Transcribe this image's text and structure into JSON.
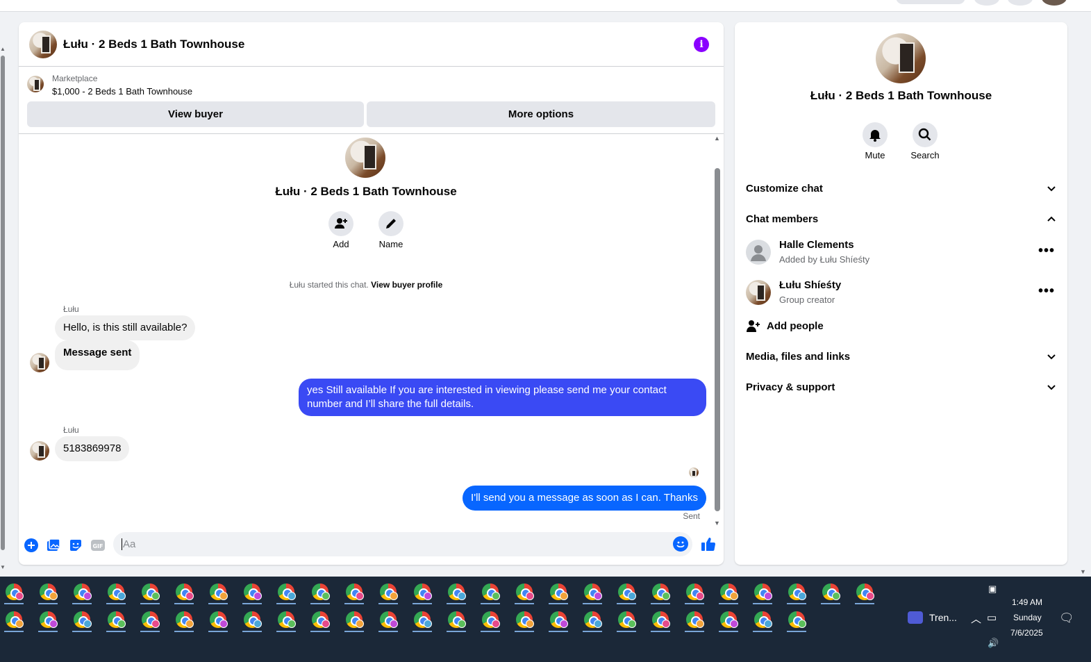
{
  "chat": {
    "title": "Łułu · 2 Beds 1 Bath Townhouse",
    "info_glyph": "i",
    "marketplace": {
      "label": "Marketplace",
      "listing": "$1,000 - 2 Beds 1 Bath Townhouse",
      "view_buyer": "View buyer",
      "more_options": "More options"
    },
    "intro": {
      "title": "Łułu · 2 Beds 1 Bath Townhouse",
      "add_label": "Add",
      "name_label": "Name",
      "system_text": "Łułu started this chat.",
      "system_link": "View buyer profile"
    },
    "messages": [
      {
        "sender": "Łułu",
        "text": "Hello, is this still available?"
      },
      {
        "text": "Message sent"
      },
      {
        "text": "yes Still available If you are interested in viewing please send me your contact number and I’ll share the full details."
      },
      {
        "sender": "Łułu",
        "text": "5183869978"
      },
      {
        "text": "I'll send you a message as soon as I can. Thanks",
        "status": "Sent"
      }
    ],
    "composer": {
      "placeholder": "Aa",
      "gif_label": "GIF"
    }
  },
  "sidebar": {
    "title": "Łułu · 2 Beds 1 Bath Townhouse",
    "mute_label": "Mute",
    "search_label": "Search",
    "customize": "Customize chat",
    "chat_members": "Chat members",
    "members": [
      {
        "name": "Halle Clements",
        "sub": "Added by Łułu Shíeśty"
      },
      {
        "name": "Łułu Shíeśty",
        "sub": "Group creator"
      }
    ],
    "add_people": "Add people",
    "media": "Media, files and links",
    "privacy": "Privacy & support"
  },
  "taskbar": {
    "app_label": "Tren...",
    "time": "1:49 AM",
    "day": "Sunday",
    "date": "7/6/2025"
  },
  "colors": {
    "accent": "#0866ff",
    "outgoing_bubble": "#3a4af4",
    "info": "#8a00ff",
    "taskbar": "#1b2838"
  }
}
